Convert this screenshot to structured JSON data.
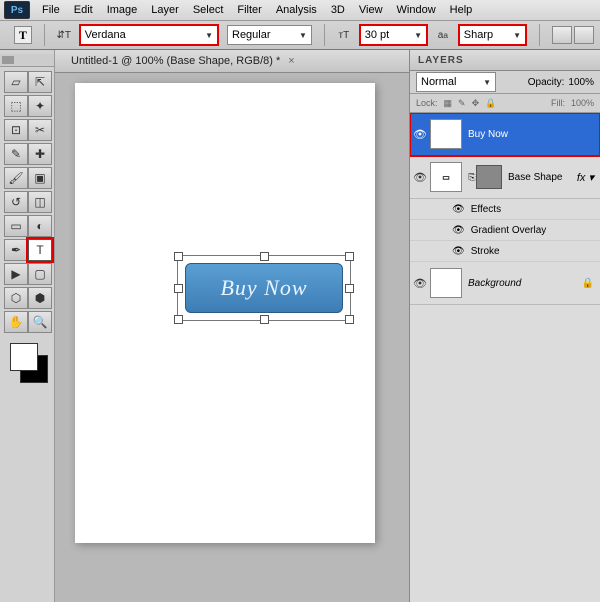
{
  "menu": [
    "File",
    "Edit",
    "Image",
    "Layer",
    "Select",
    "Filter",
    "Analysis",
    "3D",
    "View",
    "Window",
    "Help"
  ],
  "options": {
    "font": "Verdana",
    "style": "Regular",
    "size": "30 pt",
    "aa": "Sharp"
  },
  "doc_tab": "Untitled-1 @ 100% (Base Shape, RGB/8) *",
  "button_text": "Buy Now",
  "layers_panel": {
    "title": "LAYERS",
    "blend": "Normal",
    "opacity_label": "Opacity:",
    "opacity": "100%",
    "lock_label": "Lock:",
    "fill_label": "Fill:",
    "fill": "100%",
    "items": [
      {
        "name": "Buy Now"
      },
      {
        "name": "Base Shape",
        "effects": [
          "Effects",
          "Gradient Overlay",
          "Stroke"
        ]
      },
      {
        "name": "Background"
      }
    ]
  },
  "tools": [
    "move-tool",
    "direct-select-tool",
    "marquee-tool",
    "magic-wand-tool",
    "crop-tool",
    "slice-tool",
    "eyedropper-tool",
    "patch-tool",
    "brush-tool",
    "stamp-tool",
    "history-brush-tool",
    "eraser-tool",
    "gradient-tool",
    "blur-tool",
    "pen-tool",
    "type-tool",
    "path-select-tool",
    "shape-tool",
    "3d-tool",
    "3d-camera-tool",
    "hand-tool",
    "zoom-tool"
  ],
  "tool_glyphs": [
    "▱",
    "⇱",
    "⬚",
    "✦",
    "⊡",
    "✂",
    "✎",
    "✚",
    "🖌",
    "▣",
    "↺",
    "◫",
    "▭",
    "◐",
    "✒",
    "T",
    "▶",
    "▢",
    "⬡",
    "⬢",
    "✋",
    "🔍"
  ]
}
